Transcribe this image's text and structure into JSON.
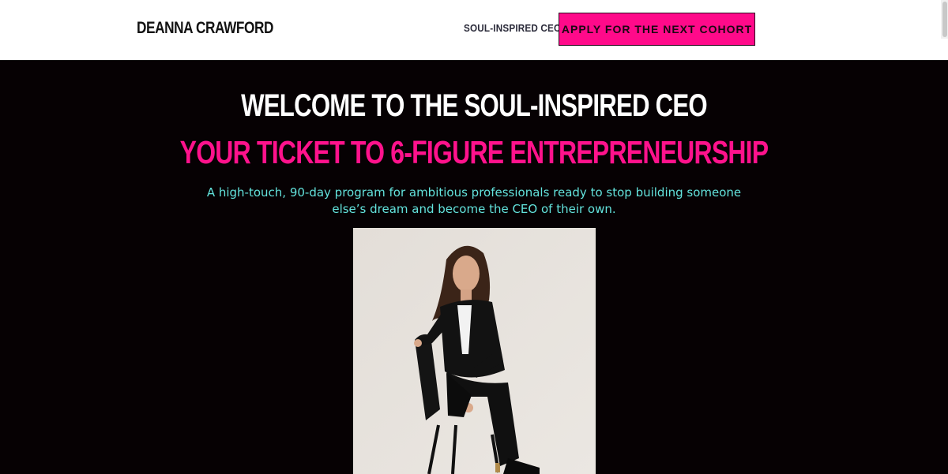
{
  "header": {
    "brand": "DEANNA CRAWFORD",
    "nav_link": "SOUL-INSPIRED CEO",
    "cta_label": "APPLY FOR THE NEXT COHORT"
  },
  "hero": {
    "title": "WELCOME TO THE SOUL-INSPIRED CEO",
    "tagline": "YOUR TICKET TO 6-FIGURE ENTREPRENEURSHIP",
    "description": "A high-touch, 90-day program for ambitious professionals ready to stop building someone else’s dream and become the CEO of their own."
  },
  "colors": {
    "accent_pink": "#ff128c",
    "teal_text": "#63e3dd",
    "background_dark": "#060103"
  }
}
